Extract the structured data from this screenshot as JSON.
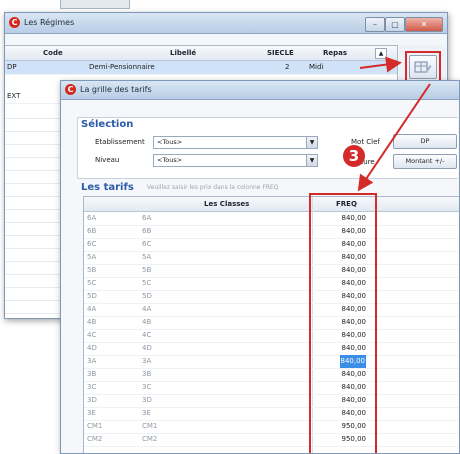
{
  "back_window": {
    "title": "Les Régimes",
    "columns": [
      "Code",
      "Libellé",
      "SIECLE",
      "Repas"
    ],
    "rows": [
      {
        "code": "DP",
        "libelle": "Demi-Pensionnaire",
        "siecle": "2",
        "repas": "Midi"
      },
      {
        "code": "EXT",
        "libelle": "",
        "siecle": "",
        "repas": ""
      }
    ],
    "win_buttons": [
      "–",
      "▢",
      "✕"
    ]
  },
  "front_window": {
    "title": "La grille des tarifs",
    "selection": {
      "title": "Sélection",
      "etablissement_label": "Etablissement",
      "etablissement_value": "<Tous>",
      "niveau_label": "Niveau",
      "niveau_value": "<Tous>",
      "motclef_label": "Mot Clef",
      "motclef_button": "DP",
      "nature_label": "Nature",
      "nature_button": "Montant +/-"
    },
    "tarifs": {
      "title": "Les tarifs",
      "hint": "Veuillez saisir les prix dans la colonne FREQ",
      "col_classes": "Les Classes",
      "col_freq": "FREQ",
      "rows": [
        {
          "c1": "6A",
          "c2": "6A",
          "freq": "840,00"
        },
        {
          "c1": "6B",
          "c2": "6B",
          "freq": "840,00"
        },
        {
          "c1": "6C",
          "c2": "6C",
          "freq": "840,00"
        },
        {
          "c1": "5A",
          "c2": "5A",
          "freq": "840,00"
        },
        {
          "c1": "5B",
          "c2": "5B",
          "freq": "840,00"
        },
        {
          "c1": "5C",
          "c2": "5C",
          "freq": "840,00"
        },
        {
          "c1": "5D",
          "c2": "5D",
          "freq": "840,00"
        },
        {
          "c1": "4A",
          "c2": "4A",
          "freq": "840,00"
        },
        {
          "c1": "4B",
          "c2": "4B",
          "freq": "840,00"
        },
        {
          "c1": "4C",
          "c2": "4C",
          "freq": "840,00"
        },
        {
          "c1": "4D",
          "c2": "4D",
          "freq": "840,00"
        },
        {
          "c1": "3A",
          "c2": "3A",
          "freq": "840,00",
          "selected": true
        },
        {
          "c1": "3B",
          "c2": "3B",
          "freq": "840,00"
        },
        {
          "c1": "3C",
          "c2": "3C",
          "freq": "840,00"
        },
        {
          "c1": "3D",
          "c2": "3D",
          "freq": "840,00"
        },
        {
          "c1": "3E",
          "c2": "3E",
          "freq": "840,00"
        },
        {
          "c1": "CM1",
          "c2": "CM1",
          "freq": "950,00"
        },
        {
          "c1": "CM2",
          "c2": "CM2",
          "freq": "950,00"
        }
      ]
    }
  },
  "annotation": {
    "number": "3",
    "color": "#d42a2a"
  },
  "colors": {
    "selection_blue": "#3b8ee6",
    "title_blue": "#2a5aa8",
    "accent_red": "#d42a2a"
  }
}
